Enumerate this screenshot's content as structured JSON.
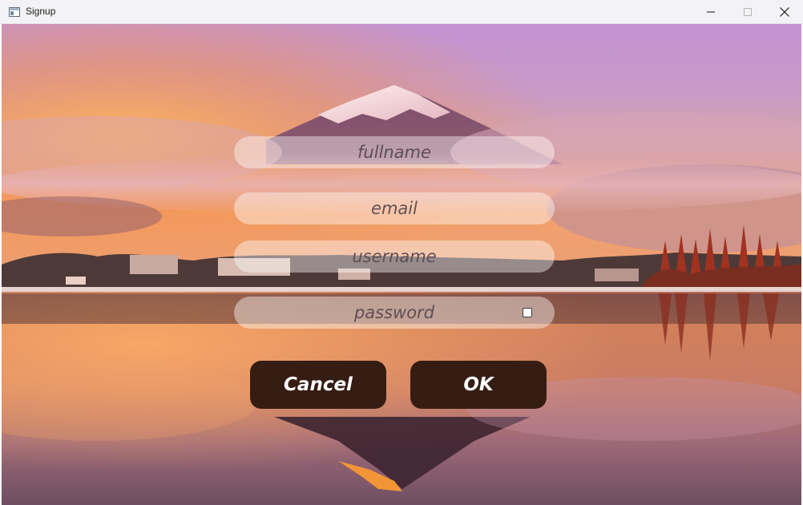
{
  "window": {
    "title": "Signup",
    "icons": {
      "app": "app-window-icon",
      "minimize": "minimize-icon",
      "maximize": "maximize-icon",
      "close": "close-icon"
    }
  },
  "form": {
    "fullname_placeholder": "fullname",
    "email_placeholder": "email",
    "username_placeholder": "username",
    "password_placeholder": "password",
    "show_password_checked": false
  },
  "buttons": {
    "cancel_label": "Cancel",
    "ok_label": "OK"
  },
  "colors": {
    "button_bg": "#361d13",
    "button_text": "#ffffff",
    "field_bg": "rgba(255,255,255,0.42)",
    "sky_top": "#c393d2",
    "sunset_orange": "#f29a55"
  }
}
